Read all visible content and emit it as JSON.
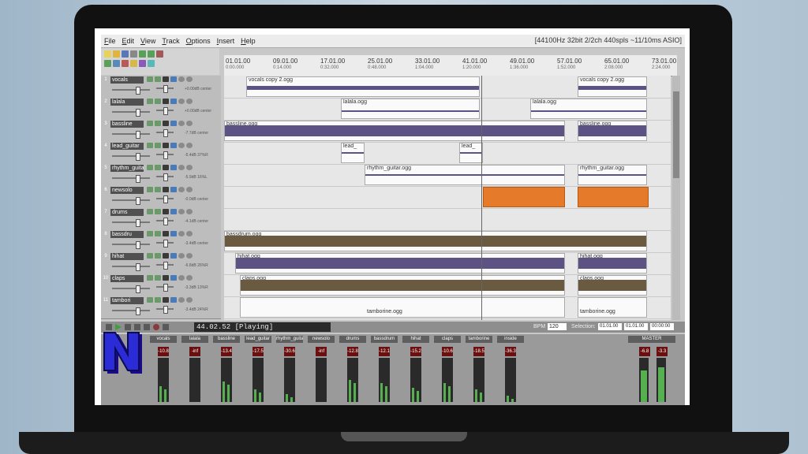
{
  "menu": [
    {
      "pre": "",
      "u": "F",
      "post": "ile"
    },
    {
      "pre": "",
      "u": "E",
      "post": "dit"
    },
    {
      "pre": "",
      "u": "V",
      "post": "iew"
    },
    {
      "pre": "",
      "u": "T",
      "post": "rack"
    },
    {
      "pre": "",
      "u": "O",
      "post": "ptions"
    },
    {
      "pre": "",
      "u": "I",
      "post": "nsert"
    },
    {
      "pre": "",
      "u": "H",
      "post": "elp"
    }
  ],
  "audio_info": "[44100Hz 32bit 2/2ch 440spls ~11/10ms ASIO]",
  "ruler": [
    {
      "bar": "01.01.00",
      "time": "0:00.000"
    },
    {
      "bar": "09.01.00",
      "time": "0:14.000"
    },
    {
      "bar": "17.01.00",
      "time": "0:32.000"
    },
    {
      "bar": "25.01.00",
      "time": "0:48.000"
    },
    {
      "bar": "33.01.00",
      "time": "1:04.000"
    },
    {
      "bar": "41.01.00",
      "time": "1:20.000"
    },
    {
      "bar": "49.01.00",
      "time": "1:36.000"
    },
    {
      "bar": "57.01.00",
      "time": "1:52.000"
    },
    {
      "bar": "65.01.00",
      "time": "2:08.000"
    },
    {
      "bar": "73.01.00",
      "time": "2:24.000"
    }
  ],
  "tracks": [
    {
      "num": "1",
      "name": "vocals",
      "vol": "+0.00dB center"
    },
    {
      "num": "2",
      "name": "lalala",
      "vol": "+0.00dB center"
    },
    {
      "num": "3",
      "name": "bassline",
      "vol": "-7.7dB center"
    },
    {
      "num": "4",
      "name": "lead_guitar",
      "vol": "-5.4dB 37%R"
    },
    {
      "num": "5",
      "name": "rhythm_guita",
      "vol": "-5.9dB 16%L"
    },
    {
      "num": "6",
      "name": "newsolo",
      "vol": "-0.0dB center"
    },
    {
      "num": "7",
      "name": "drums",
      "vol": "-4.1dB center"
    },
    {
      "num": "8",
      "name": "bassdru",
      "vol": "-3.4dB center"
    },
    {
      "num": "9",
      "name": "hihat",
      "vol": "-6.8dB 26%R"
    },
    {
      "num": "10",
      "name": "claps",
      "vol": "-3.3dB 13%R"
    },
    {
      "num": "11",
      "name": "tambori",
      "vol": "-3.4dB 24%R"
    }
  ],
  "clips": {
    "vocals_1": "vocals copy 2.ogg",
    "vocals_2": "vocals copy 2.ogg",
    "lalala_1": "lalala.ogg",
    "lalala_2": "lalala.ogg",
    "bassline_1": "bassline.ogg",
    "bassline_2": "bassline.ogg",
    "lead_1": "lead_",
    "lead_2": "lead_",
    "rhythm_1": "rhythm_guitar.ogg",
    "rhythm_2": "rhythm_guitar.ogg",
    "bassdrum_1": "bassdrum.ogg",
    "hihat_1": "hihat.ogg",
    "hihat_2": "hihat.ogg",
    "claps_1": "claps.ogg",
    "claps_2": "claps.ogg",
    "tamborine_1": "tamborine.ogg",
    "tamborine_2": "tamborine.ogg"
  },
  "transport": {
    "time": "44.02.52 [Playing]",
    "bpm_label": "BPM",
    "bpm": "120",
    "selection_label": "Selection:",
    "sel_start": "01.01.00",
    "sel_end": "01.01.00",
    "sel_len": "00:00:00"
  },
  "mixer": [
    {
      "name": "vocals",
      "vu": "-10.8"
    },
    {
      "name": "lalala",
      "vu": "-inf"
    },
    {
      "name": "bassline",
      "vu": "-13.4"
    },
    {
      "name": "lead_guitar",
      "vu": "-17.5"
    },
    {
      "name": "rhythm_guitar",
      "vu": "-30.6"
    },
    {
      "name": "newsolo",
      "vu": "-inf"
    },
    {
      "name": "drums",
      "vu": "-12.8"
    },
    {
      "name": "bassdrum",
      "vu": "-12.1"
    },
    {
      "name": "hihat",
      "vu": "-15.2"
    },
    {
      "name": "claps",
      "vu": "-10.6"
    },
    {
      "name": "tamborine",
      "vu": "-18.5"
    },
    {
      "name": "inside",
      "vu": "-36.3"
    }
  ],
  "master": {
    "label": "MASTER",
    "vu_l": "-6.8",
    "vu_r": "-3.3"
  },
  "colors": {
    "wave": "#5c5384",
    "solo_clip": "#e57a2a",
    "logo": "#2b2bd8"
  }
}
